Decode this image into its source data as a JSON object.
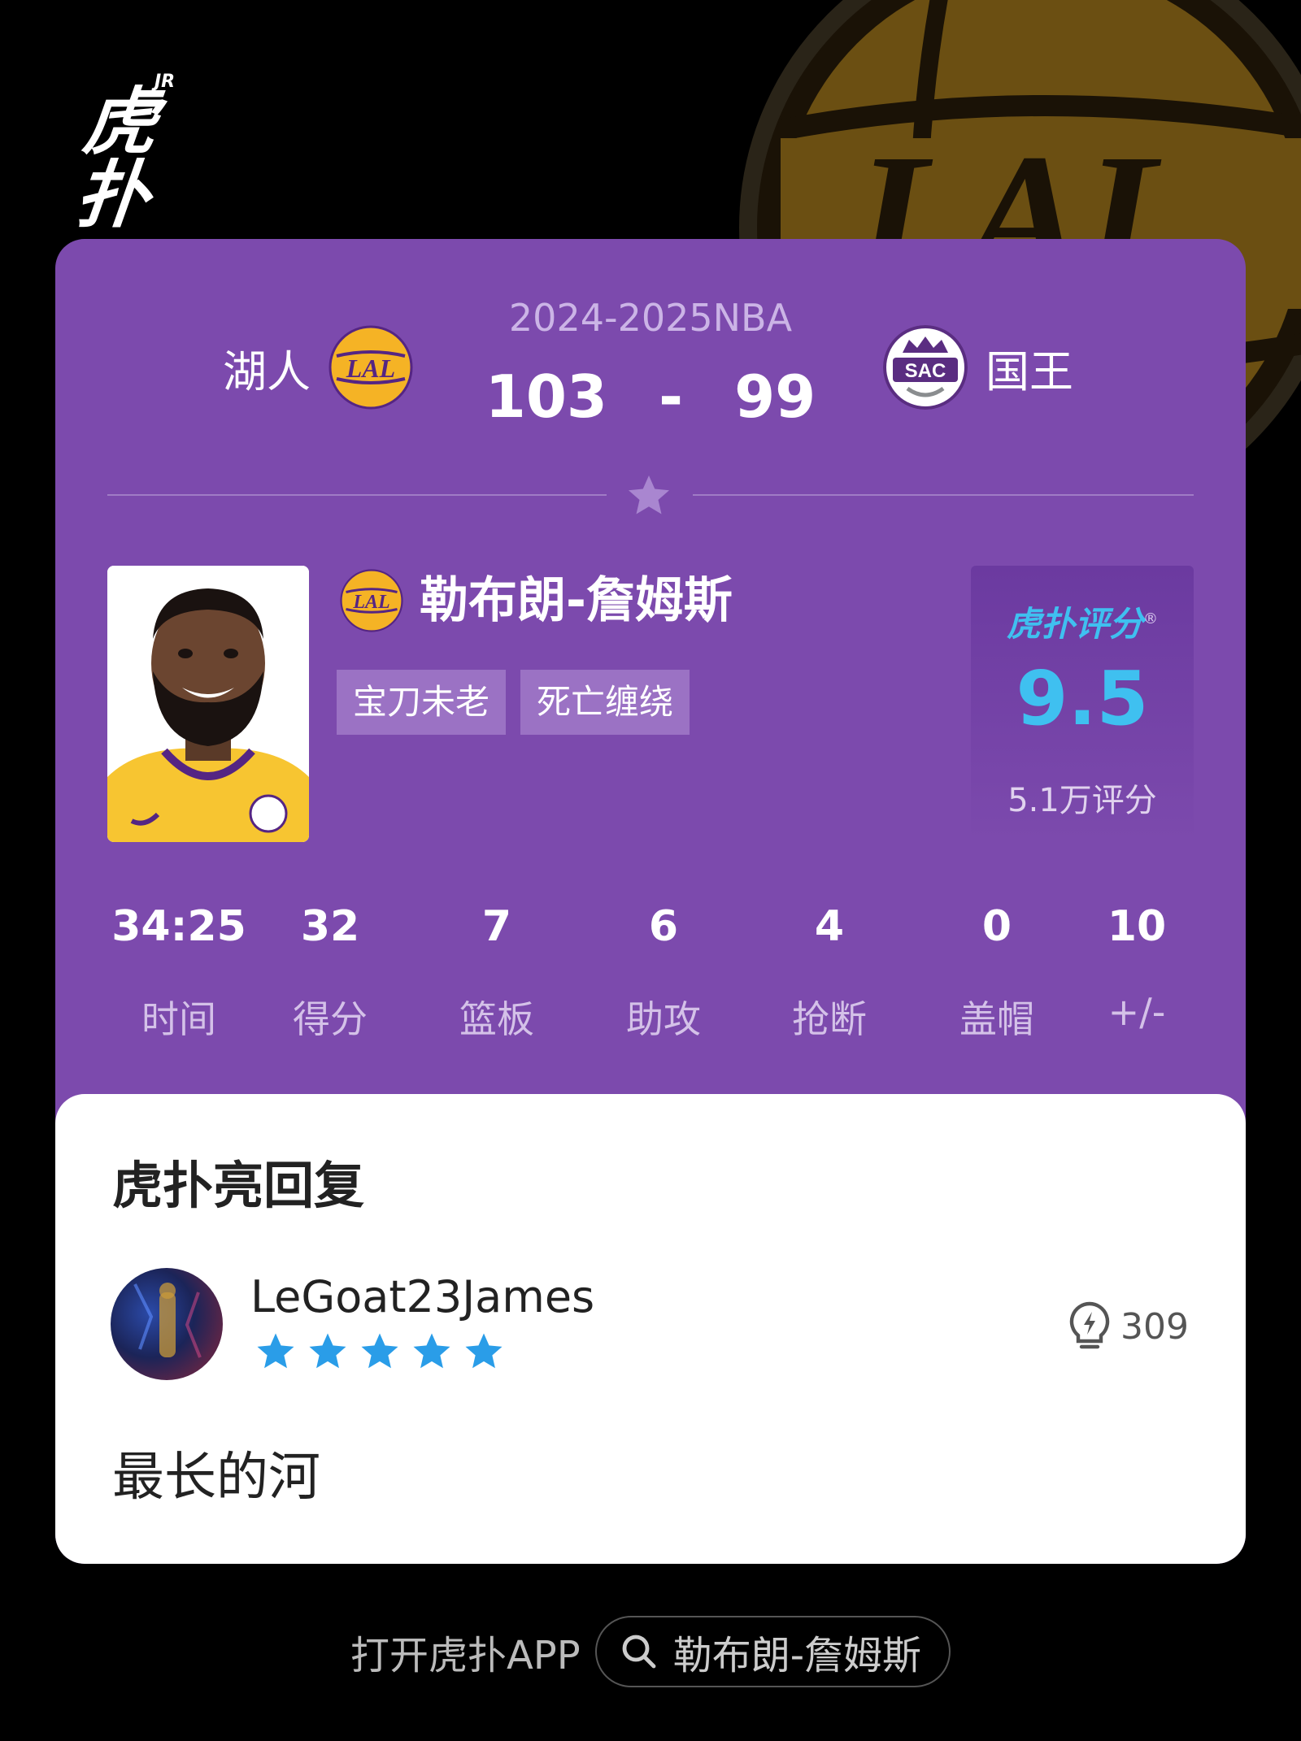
{
  "brand": {
    "name": "虎扑",
    "superscript": "JR"
  },
  "game": {
    "season": "2024-2025NBA",
    "home": {
      "name": "湖人",
      "logo_text": "LAL",
      "score": "103"
    },
    "away": {
      "name": "国王",
      "logo_text": "SAC",
      "score": "99"
    },
    "score_separator": "-"
  },
  "player": {
    "name": "勒布朗-詹姆斯",
    "team_logo_text": "LAL",
    "tags": [
      "宝刀未老",
      "死亡缠绕"
    ]
  },
  "rating": {
    "brand": "虎扑评分",
    "brand_mark": "®",
    "value": "9.5",
    "count": "5.1万评分"
  },
  "stats": [
    {
      "value": "34:25",
      "label": "时间"
    },
    {
      "value": "32",
      "label": "得分"
    },
    {
      "value": "7",
      "label": "篮板"
    },
    {
      "value": "6",
      "label": "助攻"
    },
    {
      "value": "4",
      "label": "抢断"
    },
    {
      "value": "0",
      "label": "盖帽"
    },
    {
      "value": "10",
      "label": "+/-"
    }
  ],
  "reply": {
    "title": "虎扑亮回复",
    "username": "LeGoat23James",
    "star_count": 5,
    "lights": "309",
    "text": "最长的河"
  },
  "footer": {
    "open_app": "打开虎扑APP",
    "search_query": "勒布朗-詹姆斯"
  },
  "colors": {
    "card_purple": "#7c4aad",
    "rating_blue": "#3fc0f0",
    "star_blue": "#2a9de8",
    "lakers_gold": "#f5b325",
    "lakers_purple": "#552583",
    "kings_purple": "#5a2d81"
  }
}
